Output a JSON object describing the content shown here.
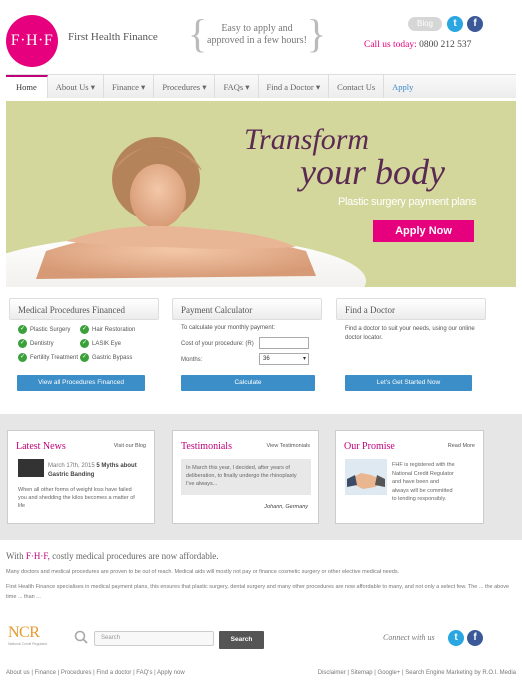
{
  "header": {
    "logo_text": "F·H·F",
    "brand": "First Health Finance",
    "tagline_line1": "Easy to apply and",
    "tagline_line2": "approved in a few hours!",
    "blog": "Blog",
    "call_label": "Call us today:",
    "phone": "0800 212 537",
    "twitter_glyph": "t",
    "facebook_glyph": "f"
  },
  "nav": {
    "items": [
      "Home",
      "About Us ▾",
      "Finance ▾",
      "Procedures ▾",
      "FAQs ▾",
      "Find a Doctor ▾",
      "Contact Us",
      "Apply"
    ]
  },
  "hero": {
    "line1": "Transform",
    "line2": "your body",
    "subtitle": "Plastic surgery payment plans",
    "button": "Apply Now"
  },
  "procedures": {
    "title": "Medical Procedures Financed",
    "items": [
      "Plastic Surgery",
      "Hair Restoration",
      "Dentistry",
      "LASIK Eye",
      "Fertility Treatment",
      "Gastric Bypass"
    ],
    "button": "View all Procedures Financed"
  },
  "calculator": {
    "title": "Payment Calculator",
    "intro": "To calculate your monthly payment:",
    "cost_label": "Cost of your procedure: (R)",
    "cost_value": "",
    "months_label": "Months:",
    "months_value": "36",
    "button": "Calculate"
  },
  "doctor": {
    "title": "Find a Doctor",
    "text_line1": "Find a doctor to suit your needs, using our online",
    "text_line2": "doctor locator.",
    "button": "Let's Get Started Now"
  },
  "latest_news": {
    "title": "Latest News",
    "link": "Visit our Blog",
    "date": "March 17th, 2015",
    "headline_1": "5 Myths about",
    "headline_2": "Gastric Banding",
    "body_1": "When all other forms of weight loss have failed",
    "body_2": "you and shedding the kilos becomes a matter of",
    "body_3": "life"
  },
  "testimonials": {
    "title": "Testimonials",
    "link": "View Testimonials",
    "quote_1": "In March this year, I decided, after years of",
    "quote_2": "deliberation, to finally undergo the rhinoplasty",
    "quote_3": "I've always...",
    "author": "Johann, Germany"
  },
  "promise": {
    "title": "Our Promise",
    "link": "Read More",
    "text_1": "FHF is registered with the",
    "text_2": "National Credit Regulator",
    "text_3": "and have been and",
    "text_4": "always will be committed",
    "text_5": "to lending responsibly."
  },
  "intro": {
    "prefix": "With",
    "brand": "F·H·F,",
    "rest": "costly medical procedures are now affordable."
  },
  "paragraphs": {
    "p1": "Many doctors and medical procedures are proven to be out of reach. Medical aids will mostly not pay or finance cosmetic surgery or other elective medical needs.",
    "p2": "First Health Finance specialises in medical payment plans, this ensures that plastic surgery, dental surgery and many other procedures are now affordable to many, and not only a select few. The ...  the above time ... than ..."
  },
  "footer": {
    "ncr_logo": "NCR",
    "ncr_sub": "National Credit Regulator",
    "search_placeholder": "Search",
    "search_button": "Search",
    "connect": "Connect with us",
    "links": "About us | Finance | Procedures | Find a doctor | FAQ's | Apply now",
    "credits": "Disclaimer | Sitemap | Google+ | Search Engine Marketing by R.O.I. Media"
  }
}
